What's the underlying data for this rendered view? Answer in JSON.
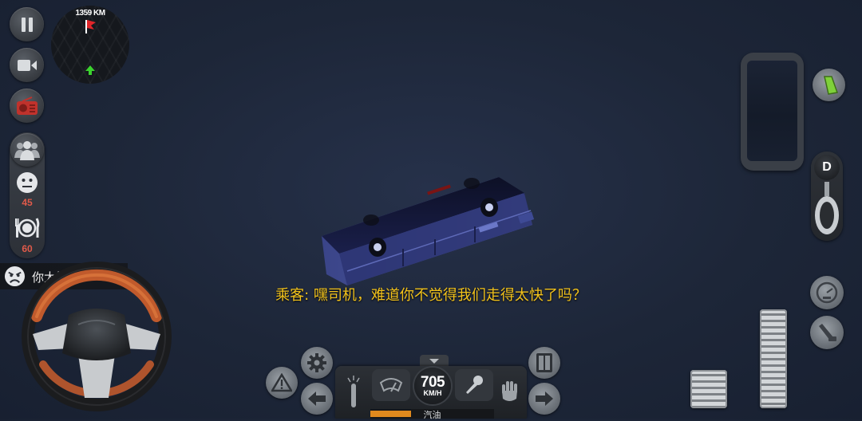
{
  "minimap": {
    "distance": "1359 KM"
  },
  "left_panel": {
    "buttons": [
      "pause-icon",
      "camera-icon",
      "radio-icon"
    ],
    "passenger_stats": {
      "happiness": "45",
      "food": "60"
    }
  },
  "notification": {
    "text": "你太快了"
  },
  "subtitle": {
    "text": "乘客: 嘿司机，难道你不觉得我们走得太快了吗？"
  },
  "dashboard": {
    "speed": "705",
    "speed_unit": "KM/H",
    "fuel_label": "汽油",
    "fuel_level": 0.33
  },
  "gear": {
    "current": "D"
  },
  "colors": {
    "accent_yellow": "#f2c21b",
    "radio_red": "#c0322c",
    "stat_red": "#e05a4a",
    "fuel_orange": "#e08a1e",
    "map_arrow_green": "#3bd22e",
    "map_marker_red": "#e0262a"
  }
}
